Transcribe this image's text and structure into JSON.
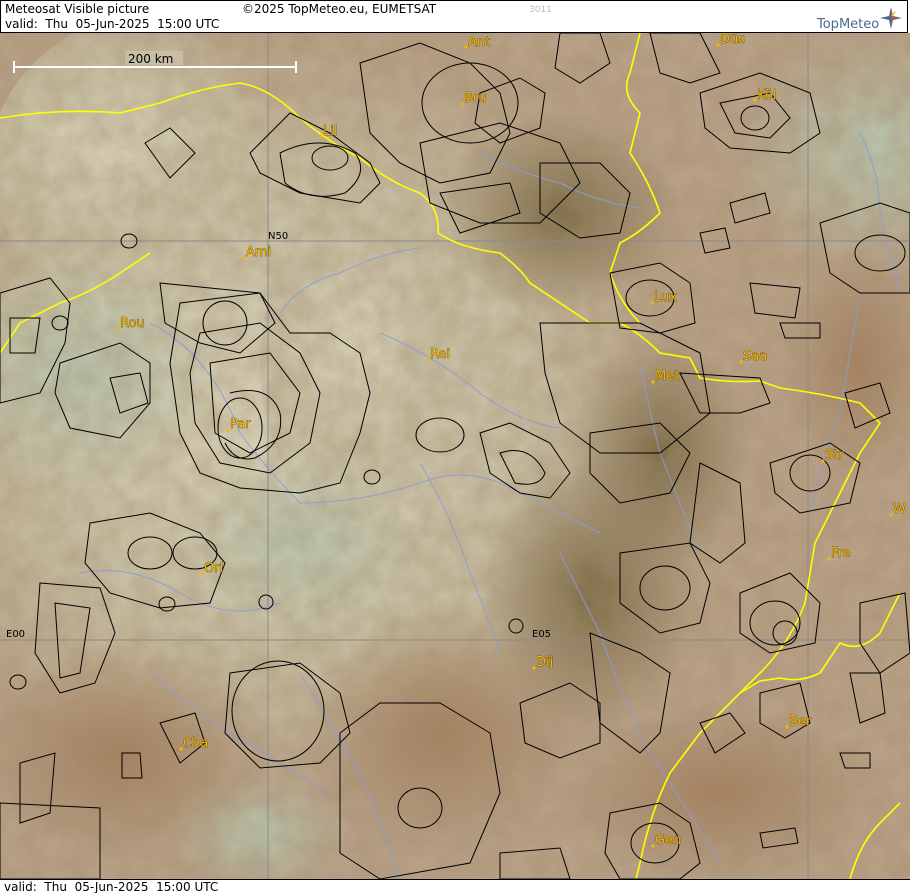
{
  "header": {
    "product": "Meteosat Visible picture",
    "valid": "valid:  Thu  05-Jun-2025  15:00 UTC",
    "copyright": "©2025 TopMeteo.eu, EUMETSAT",
    "code": "3011",
    "logo_text": "TopMeteo"
  },
  "footer": {
    "valid": "valid:  Thu  05-Jun-2025  15:00 UTC"
  },
  "map": {
    "scale_label": "200 km",
    "grid_labels": {
      "lat50": "N50",
      "lon0": "E00",
      "lon5": "E05"
    },
    "cities": [
      {
        "name": "Ant"
      },
      {
        "name": "Düs"
      },
      {
        "name": "Bru"
      },
      {
        "name": "Köl"
      },
      {
        "name": "Lil"
      },
      {
        "name": "Ami"
      },
      {
        "name": "Rou"
      },
      {
        "name": "Lux"
      },
      {
        "name": "Rei"
      },
      {
        "name": "Saa"
      },
      {
        "name": "Met"
      },
      {
        "name": "Par"
      },
      {
        "name": "Str"
      },
      {
        "name": "W"
      },
      {
        "name": "Fre"
      },
      {
        "name": "Orl"
      },
      {
        "name": "Dij"
      },
      {
        "name": "Ber"
      },
      {
        "name": "Cha"
      },
      {
        "name": "Gen"
      }
    ],
    "colors": {
      "border": "#ffff00",
      "river": "#8a9bd8",
      "grid": "#8a8a8a",
      "airspace": "#000000",
      "city": "#f5b800"
    }
  }
}
